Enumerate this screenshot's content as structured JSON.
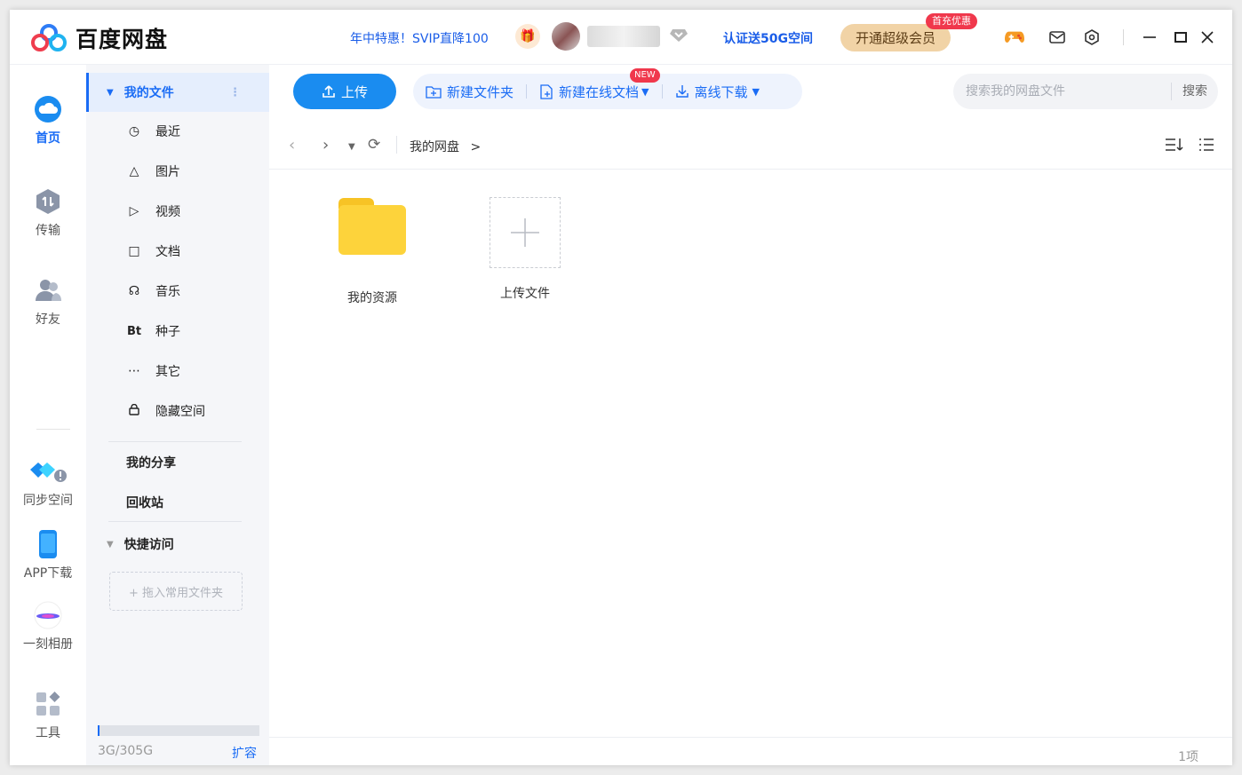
{
  "app": {
    "name": "百度网盘"
  },
  "titlebar": {
    "promo": "年中特惠！SVIP直降100",
    "certify": "认证送50G空间",
    "vip_button": "开通超级会员",
    "vip_badge": "首充优惠",
    "icons": [
      "game-icon",
      "mail-icon",
      "settings-icon",
      "minimize-icon",
      "maximize-icon",
      "close-icon"
    ]
  },
  "rail": {
    "items": [
      {
        "label": "首页",
        "icon": "cloud-icon",
        "active": true
      },
      {
        "label": "传输",
        "icon": "transfer-icon"
      },
      {
        "label": "好友",
        "icon": "friends-icon"
      },
      {
        "label": "同步空间",
        "icon": "sync-icon"
      },
      {
        "label": "APP下载",
        "icon": "phone-icon"
      },
      {
        "label": "一刻相册",
        "icon": "album-icon"
      },
      {
        "label": "工具",
        "icon": "tools-icon"
      }
    ]
  },
  "sidebar": {
    "my_files": "我的文件",
    "items": [
      {
        "label": "最近",
        "icon": "clock-icon"
      },
      {
        "label": "图片",
        "icon": "image-icon"
      },
      {
        "label": "视频",
        "icon": "video-icon"
      },
      {
        "label": "文档",
        "icon": "document-icon"
      },
      {
        "label": "音乐",
        "icon": "headphone-icon"
      },
      {
        "label": "种子",
        "icon": "bt-icon",
        "glyph": "Bt"
      },
      {
        "label": "其它",
        "icon": "more-icon"
      },
      {
        "label": "隐藏空间",
        "icon": "lock-icon"
      }
    ],
    "my_share": "我的分享",
    "recycle": "回收站",
    "quick_access": "快捷访问",
    "drop_hint": "+ 拖入常用文件夹",
    "quota_text": "3G/305G",
    "quota_fraction": 0.0098,
    "expand": "扩容"
  },
  "toolbar": {
    "upload": "上传",
    "new_folder": "新建文件夹",
    "new_doc": "新建在线文档",
    "new_badge": "NEW",
    "offline_download": "离线下载",
    "search_placeholder": "搜索我的网盘文件",
    "search_button": "搜索"
  },
  "nav": {
    "breadcrumb": "我的网盘",
    "breadcrumb_sep": ">"
  },
  "files": [
    {
      "name": "我的资源",
      "type": "folder"
    },
    {
      "name": "上传文件",
      "type": "upload-placeholder"
    }
  ],
  "status": {
    "count": "1项"
  },
  "colors": {
    "accent": "#1a6cf5",
    "vip": "#f1d3a6",
    "folder": "#fdd33b",
    "badge": "#f0384c"
  }
}
